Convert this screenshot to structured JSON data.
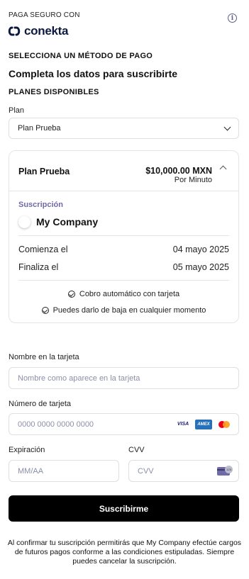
{
  "header": {
    "secure_label": "PAGA SEGURO CON",
    "brand": "conekta"
  },
  "method_heading": "SELECCIONA UN MÉTODO DE PAGO",
  "form_title": "Completa los datos para suscribirte",
  "plans_heading": "PLANES DISPONIBLES",
  "plan_field": {
    "label": "Plan",
    "value": "Plan Prueba"
  },
  "plan_card": {
    "name": "Plan Prueba",
    "price": "$10,000.00 MXN",
    "period": "Por Minuto",
    "subscription_label": "Suscripción",
    "company": "My Company",
    "start_label": "Comienza el",
    "start_date": "04 mayo 2025",
    "end_label": "Finaliza el",
    "end_date": "05 mayo 2025",
    "feature_1": "Cobro automático con tarjeta",
    "feature_2": "Puedes darlo de baja en cualquier momento"
  },
  "card_name": {
    "label": "Nombre en la tarjeta",
    "placeholder": "Nombre como aparece en la tarjeta"
  },
  "card_number": {
    "label": "Número de tarjeta",
    "placeholder": "0000 0000 0000 0000",
    "brands": [
      "VISA",
      "AMEX",
      "mastercard"
    ]
  },
  "expiration": {
    "label": "Expiración",
    "placeholder": "MM/AA"
  },
  "cvv": {
    "label": "CVV",
    "placeholder": "CVV",
    "badge": "123"
  },
  "submit_label": "Suscribirme",
  "footer_text": "Al confirmar tu suscripción permitirás que My Company efectúe cargos de futuros pagos conforme a las condiciones estipuladas. Siempre puedes cancelar la suscripción.",
  "colors": {
    "brand_navy": "#0c1a3f",
    "accent_purple": "#6f6aa8",
    "button_black": "#000000",
    "border": "#dcdfe6"
  }
}
